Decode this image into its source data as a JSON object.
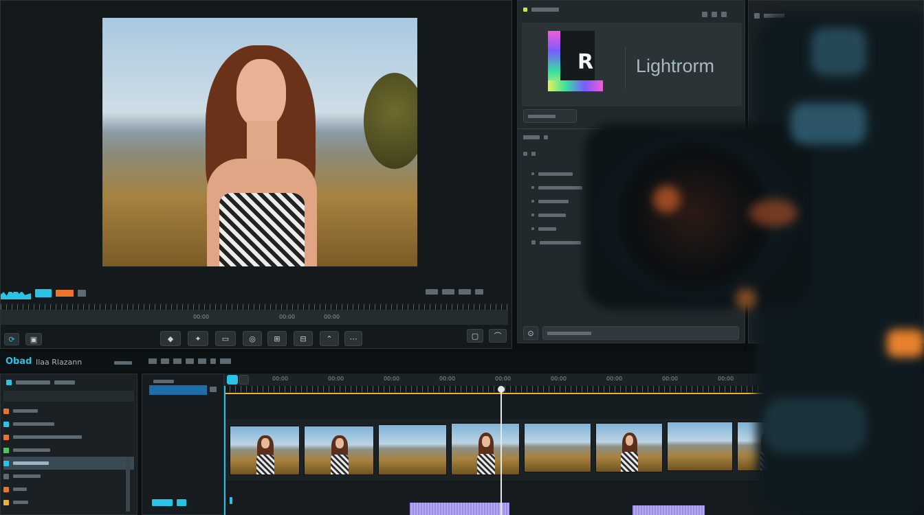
{
  "app": {
    "logo_letter": "R",
    "brand_name": "Lightrorm"
  },
  "preview": {
    "timecode_left": "00:00",
    "timecode_mid": "00:00",
    "timecode_right": "00:00"
  },
  "timeline": {
    "title": "Obad",
    "subtitle": "Ilaa Rlazann",
    "ruler_marks": [
      "00:00",
      "00:00",
      "00:00",
      "00:00",
      "00:00",
      "00:00",
      "00:00",
      "00:00",
      "00:00",
      "00:00"
    ]
  },
  "colors": {
    "accent": "#29c3e6",
    "playhead": "#e6e9ec",
    "timeline_line": "#f0b429",
    "clip_purple": "#9b8de6"
  }
}
